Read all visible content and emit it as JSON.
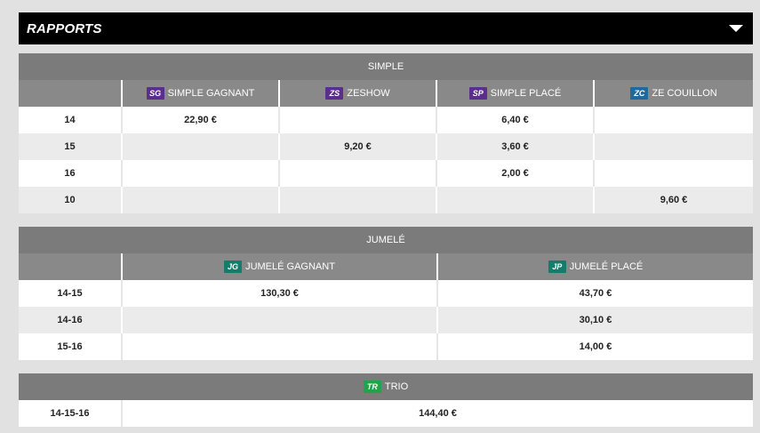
{
  "header": {
    "title": "RAPPORTS"
  },
  "colors": {
    "purple": "#5a2d8f",
    "blue": "#1d6aa0",
    "teal": "#137c6a",
    "green": "#21a34a"
  },
  "simple": {
    "title": "SIMPLE",
    "columns": [
      {
        "badge": "SG",
        "label": "SIMPLE GAGNANT"
      },
      {
        "badge": "ZS",
        "label": "ZESHOW"
      },
      {
        "badge": "SP",
        "label": "SIMPLE PLACÉ"
      },
      {
        "badge": "ZC",
        "label": "ZE COUILLON"
      }
    ],
    "rows": [
      {
        "horse": "14",
        "values": [
          "22,90 €",
          "",
          "6,40 €",
          ""
        ]
      },
      {
        "horse": "15",
        "values": [
          "",
          "9,20 €",
          "3,60 €",
          ""
        ]
      },
      {
        "horse": "16",
        "values": [
          "",
          "",
          "2,00 €",
          ""
        ]
      },
      {
        "horse": "10",
        "values": [
          "",
          "",
          "",
          "9,60 €"
        ]
      }
    ]
  },
  "jumele": {
    "title": "JUMELÉ",
    "columns": [
      {
        "badge": "JG",
        "label": "JUMELÉ GAGNANT"
      },
      {
        "badge": "JP",
        "label": "JUMELÉ PLACÉ"
      }
    ],
    "rows": [
      {
        "combo": "14-15",
        "values": [
          "130,30 €",
          "43,70 €"
        ]
      },
      {
        "combo": "14-16",
        "values": [
          "",
          "30,10 €"
        ]
      },
      {
        "combo": "15-16",
        "values": [
          "",
          "14,00 €"
        ]
      }
    ]
  },
  "trio": {
    "badge": "Tr",
    "title": "TRIO",
    "rows": [
      {
        "combo": "14-15-16",
        "value": "144,40 €"
      }
    ]
  }
}
